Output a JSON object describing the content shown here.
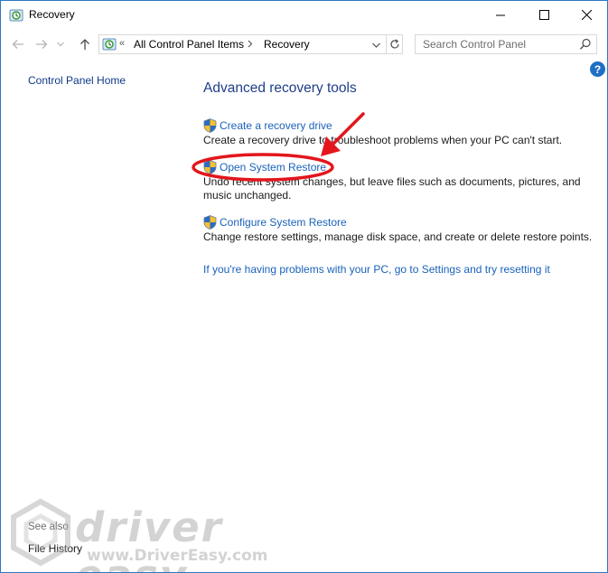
{
  "window": {
    "title": "Recovery",
    "icon": "recovery-icon"
  },
  "address_bar": {
    "overflow_chevron": "«",
    "breadcrumbs": [
      "All Control Panel Items",
      "Recovery"
    ],
    "search_placeholder": "Search Control Panel"
  },
  "left_pane": {
    "home_link": "Control Panel Home",
    "see_also_label": "See also",
    "see_also_items": [
      "File History"
    ]
  },
  "help": {
    "label": "?"
  },
  "main": {
    "heading": "Advanced recovery tools",
    "tasks": [
      {
        "label": "Create a recovery drive",
        "description": "Create a recovery drive to troubleshoot problems when your PC can't start.",
        "icon": "uac-shield-icon"
      },
      {
        "label": "Open System Restore",
        "description": "Undo recent system changes, but leave files such as documents, pictures, and music unchanged.",
        "icon": "uac-shield-icon"
      },
      {
        "label": "Configure System Restore",
        "description": "Change restore settings, manage disk space, and create or delete restore points.",
        "icon": "uac-shield-icon"
      }
    ],
    "reset_link": "If you're having problems with your PC, go to Settings and try resetting it"
  },
  "watermark": {
    "brand": "driver easy",
    "url": "www.DriverEasy.com"
  },
  "colors": {
    "link": "#1a62ba",
    "heading": "#1e3f8a",
    "annotation": "#e3161c",
    "window_border": "#2b78c4"
  }
}
